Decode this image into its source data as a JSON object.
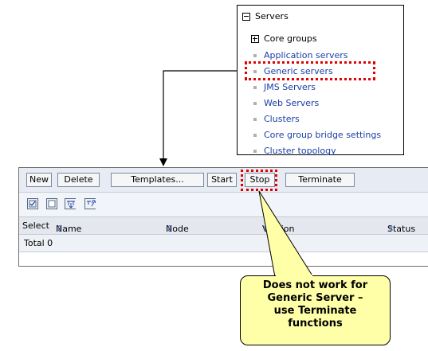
{
  "nav": {
    "header": "Servers",
    "items": [
      {
        "label": "Core groups",
        "type": "expander"
      },
      {
        "label": "Application servers",
        "type": "link"
      },
      {
        "label": "Generic servers",
        "type": "link"
      },
      {
        "label": "JMS Servers",
        "type": "link"
      },
      {
        "label": "Web Servers",
        "type": "link"
      },
      {
        "label": "Clusters",
        "type": "link"
      },
      {
        "label": "Core group bridge settings",
        "type": "link"
      },
      {
        "label": "Cluster topology",
        "type": "link"
      }
    ]
  },
  "toolbar": {
    "new_label": "New",
    "delete_label": "Delete",
    "templates_label": "Templates...",
    "start_label": "Start",
    "stop_label": "Stop",
    "terminate_label": "Terminate"
  },
  "icons": [
    "select-all-icon",
    "deselect-all-icon",
    "show-filter-icon",
    "clear-filter-icon"
  ],
  "table": {
    "columns": [
      "Select",
      "Name",
      "Node",
      "Version",
      "Status"
    ],
    "total": "Total 0"
  },
  "callout": {
    "lines": [
      "Does not work for",
      "Generic Server –",
      "use Terminate",
      "functions"
    ]
  },
  "colors": {
    "highlight": "#e00000",
    "callout_bg": "#ffffa8",
    "link": "#1a3ea6",
    "toolbar_bg": "#e7ecf4"
  }
}
